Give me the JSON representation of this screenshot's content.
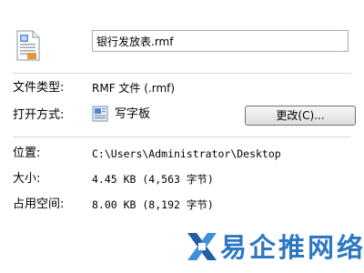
{
  "file": {
    "icon": "document-icon",
    "name": "银行发放表.rmf"
  },
  "properties": {
    "type_label": "文件类型:",
    "type_value": "RMF 文件 (.rmf)",
    "openwith_label": "打开方式:",
    "openwith_icon": "wordpad-icon",
    "openwith_app": "写字板",
    "change_button": "更改(C)...",
    "location_label": "位置:",
    "location_value": "C:\\Users\\Administrator\\Desktop",
    "size_label": "大小:",
    "size_value": "4.45 KB (4,563 字节)",
    "disk_label": "占用空间:",
    "disk_value": "8.00 KB (8,192 字节)"
  },
  "watermark": {
    "logo": "x-logo-icon",
    "text": "易企推网络"
  },
  "colors": {
    "separator": "#d5d9de",
    "input_border": "#a9aeb7",
    "watermark_blue": "#2d78c3"
  }
}
